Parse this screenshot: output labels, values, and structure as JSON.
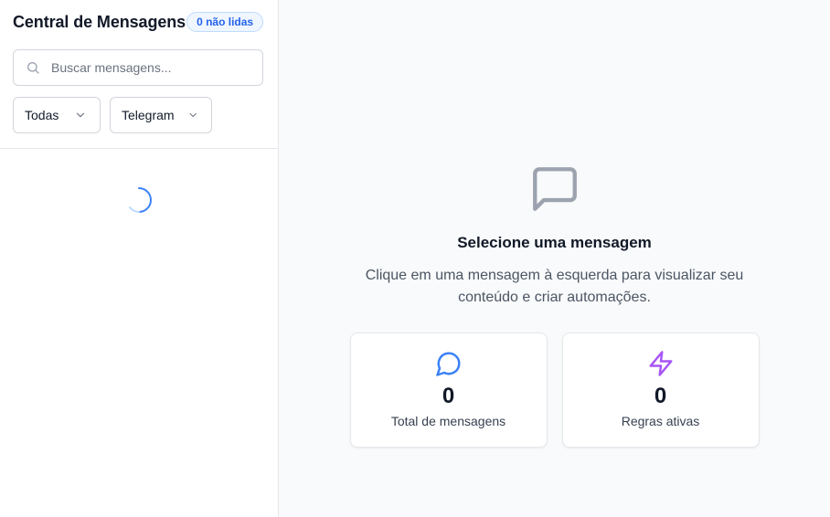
{
  "sidebar": {
    "title": "Central de Mensagens",
    "unread_badge": "0 não lidas",
    "search": {
      "placeholder": "Buscar mensagens...",
      "value": ""
    },
    "filters": {
      "status": {
        "selected": "Todas"
      },
      "channel": {
        "selected": "Telegram"
      }
    },
    "list_state": "loading"
  },
  "main": {
    "empty_state": {
      "icon": "message-square-icon",
      "title": "Selecione uma mensagem",
      "description": "Clique em uma mensagem à esquerda para visualizar seu conteúdo e criar automações."
    },
    "stats": [
      {
        "icon": "message-circle-icon",
        "value": "0",
        "label": "Total de mensagens",
        "color": "#3b82f6"
      },
      {
        "icon": "zap-icon",
        "value": "0",
        "label": "Regras ativas",
        "color": "#a855f7"
      }
    ]
  },
  "colors": {
    "accent_blue": "#2563eb",
    "accent_purple": "#a855f7",
    "muted_icon": "#9ca3af"
  }
}
